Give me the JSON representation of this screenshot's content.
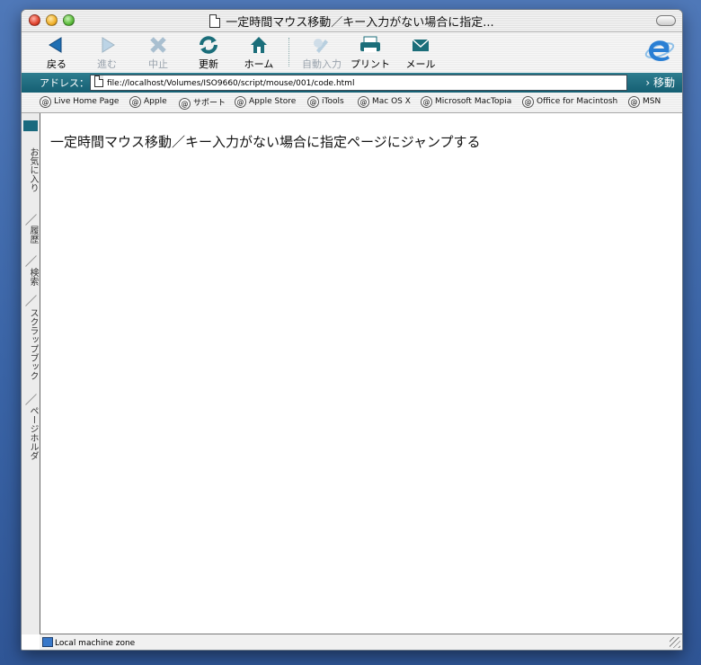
{
  "window": {
    "title": "一定時間マウス移動／キー入力がない場合に指定..."
  },
  "toolbar": {
    "back": "戻る",
    "forward": "進む",
    "stop": "中止",
    "refresh": "更新",
    "home": "ホーム",
    "autofill": "自動入力",
    "print": "プリント",
    "mail": "メール"
  },
  "address": {
    "label": "アドレス：",
    "url": "file://localhost/Volumes/ISO9660/script/mouse/001/code.html",
    "go": "移動"
  },
  "favorites": [
    "Live Home Page",
    "Apple",
    "サポート",
    "Apple Store",
    "iTools",
    "Mac OS X",
    "Microsoft MacTopia",
    "Office for Macintosh",
    "MSN"
  ],
  "sidebar_tabs": [
    "お気に入り",
    "履歴",
    "検索",
    "スクラップブック",
    "ページホルダ"
  ],
  "page": {
    "heading": "一定時間マウス移動／キー入力がない場合に指定ページにジャンプする"
  },
  "status": {
    "zone": "Local machine zone"
  },
  "colors": {
    "accent": "#1a6a7e",
    "desktop": "#3a64a6"
  }
}
